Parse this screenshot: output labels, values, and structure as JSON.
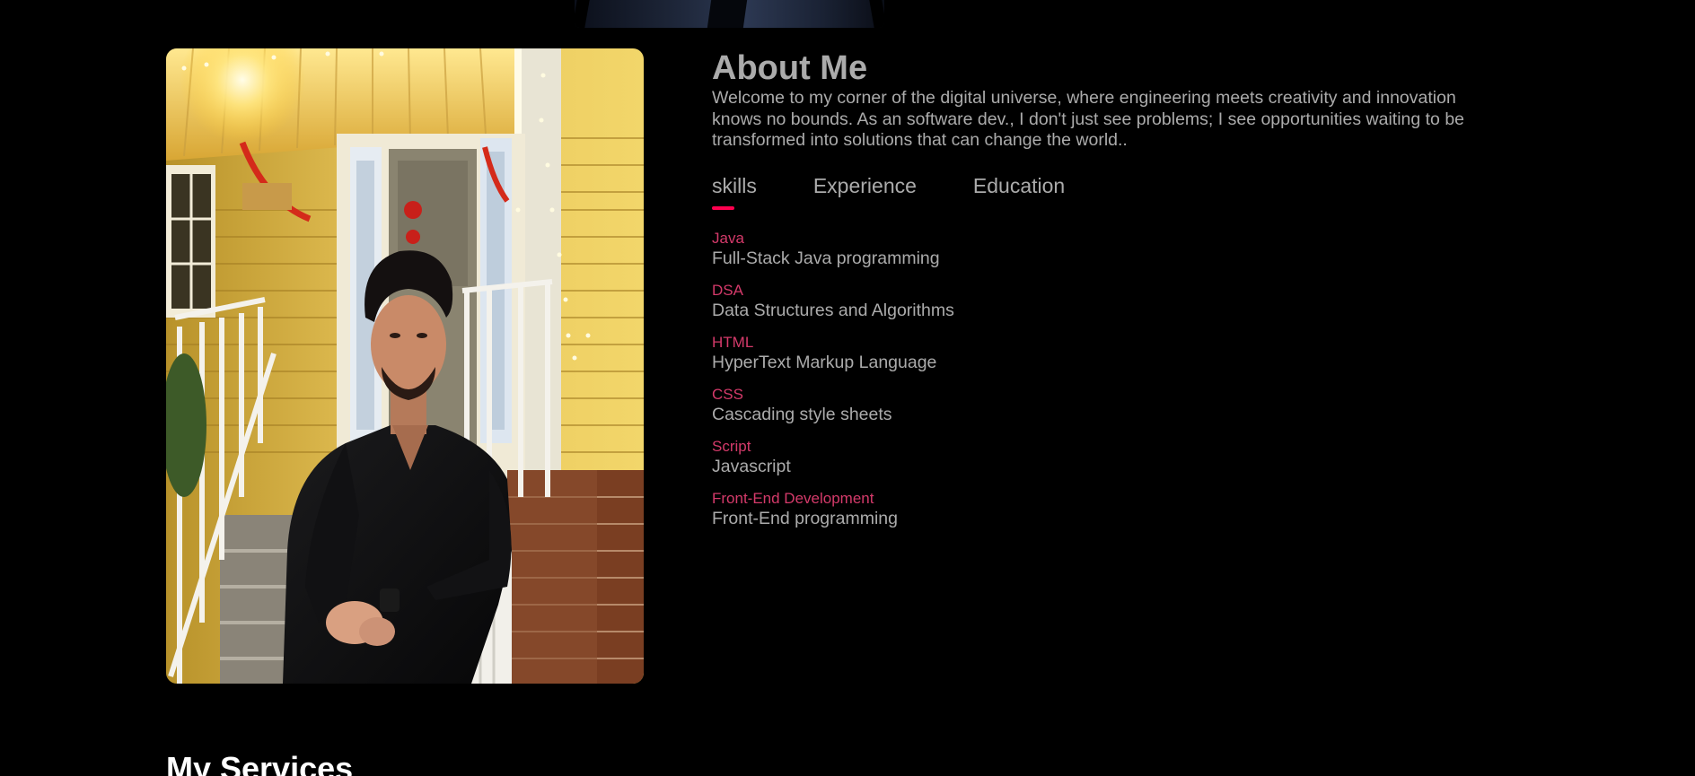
{
  "about": {
    "title": "About Me",
    "intro": "Welcome to my corner of the digital universe, where engineering meets creativity and innovation knows no bounds. As an software dev., I don't just see problems; I see opportunities waiting to be transformed into solutions that can change the world..",
    "tabs": [
      {
        "label": "skills",
        "active": true
      },
      {
        "label": "Experience",
        "active": false
      },
      {
        "label": "Education",
        "active": false
      }
    ],
    "skills": [
      {
        "name": "Java",
        "description": "Full-Stack Java programming"
      },
      {
        "name": "DSA",
        "description": "Data Structures and Algorithms"
      },
      {
        "name": "HTML",
        "description": "HyperText Markup Language"
      },
      {
        "name": "CSS",
        "description": "Cascading style sheets"
      },
      {
        "name": "Script",
        "description": "Javascript"
      },
      {
        "name": "Front-End Development",
        "description": "Front-End programming"
      }
    ]
  },
  "services": {
    "title": "My Services"
  },
  "colors": {
    "background": "#000000",
    "text": "#ababab",
    "accent": "#ff004f",
    "skill_name": "#d43a6a",
    "heading_white": "#ffffff"
  }
}
